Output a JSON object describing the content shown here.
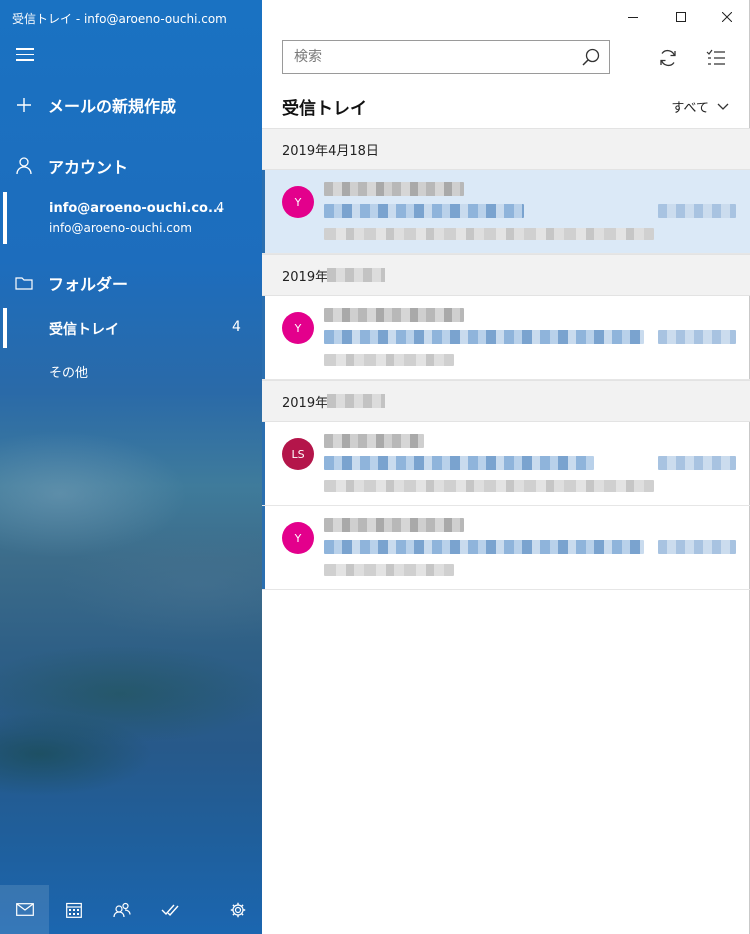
{
  "window": {
    "title": "受信トレイ - info@aroeno-ouchi.com"
  },
  "nav": {
    "menu_icon": "hamburger-icon",
    "new_mail_label": "メールの新規作成",
    "accounts_label": "アカウント",
    "account": {
      "display": "info@aroeno-ouchi.co...",
      "count": "4",
      "email": "info@aroeno-ouchi.com"
    },
    "folders_label": "フォルダー",
    "folders": [
      {
        "label": "受信トレイ",
        "count": "4"
      },
      {
        "label": "その他",
        "count": ""
      }
    ],
    "bottom_icons": [
      "mail-icon",
      "calendar-icon",
      "people-icon",
      "todo-icon",
      "settings-icon"
    ]
  },
  "search": {
    "placeholder": "検索"
  },
  "list": {
    "title": "受信トレイ",
    "filter_label": "すべて",
    "groups": [
      {
        "date": "2019年4月18日",
        "messages": [
          {
            "initials": "Y",
            "avatar_color": "#e3008c",
            "selected": true
          }
        ]
      },
      {
        "date": "2019年",
        "messages": [
          {
            "initials": "Y",
            "avatar_color": "#e3008c",
            "selected": false
          }
        ]
      },
      {
        "date": "2019年",
        "messages": [
          {
            "initials": "LS",
            "avatar_color": "#b4154a",
            "selected": false
          },
          {
            "initials": "Y",
            "avatar_color": "#e3008c",
            "selected": false
          }
        ]
      }
    ]
  },
  "colors": {
    "accent": "#2b6fb0",
    "selected_bg": "#dbe9f7"
  }
}
